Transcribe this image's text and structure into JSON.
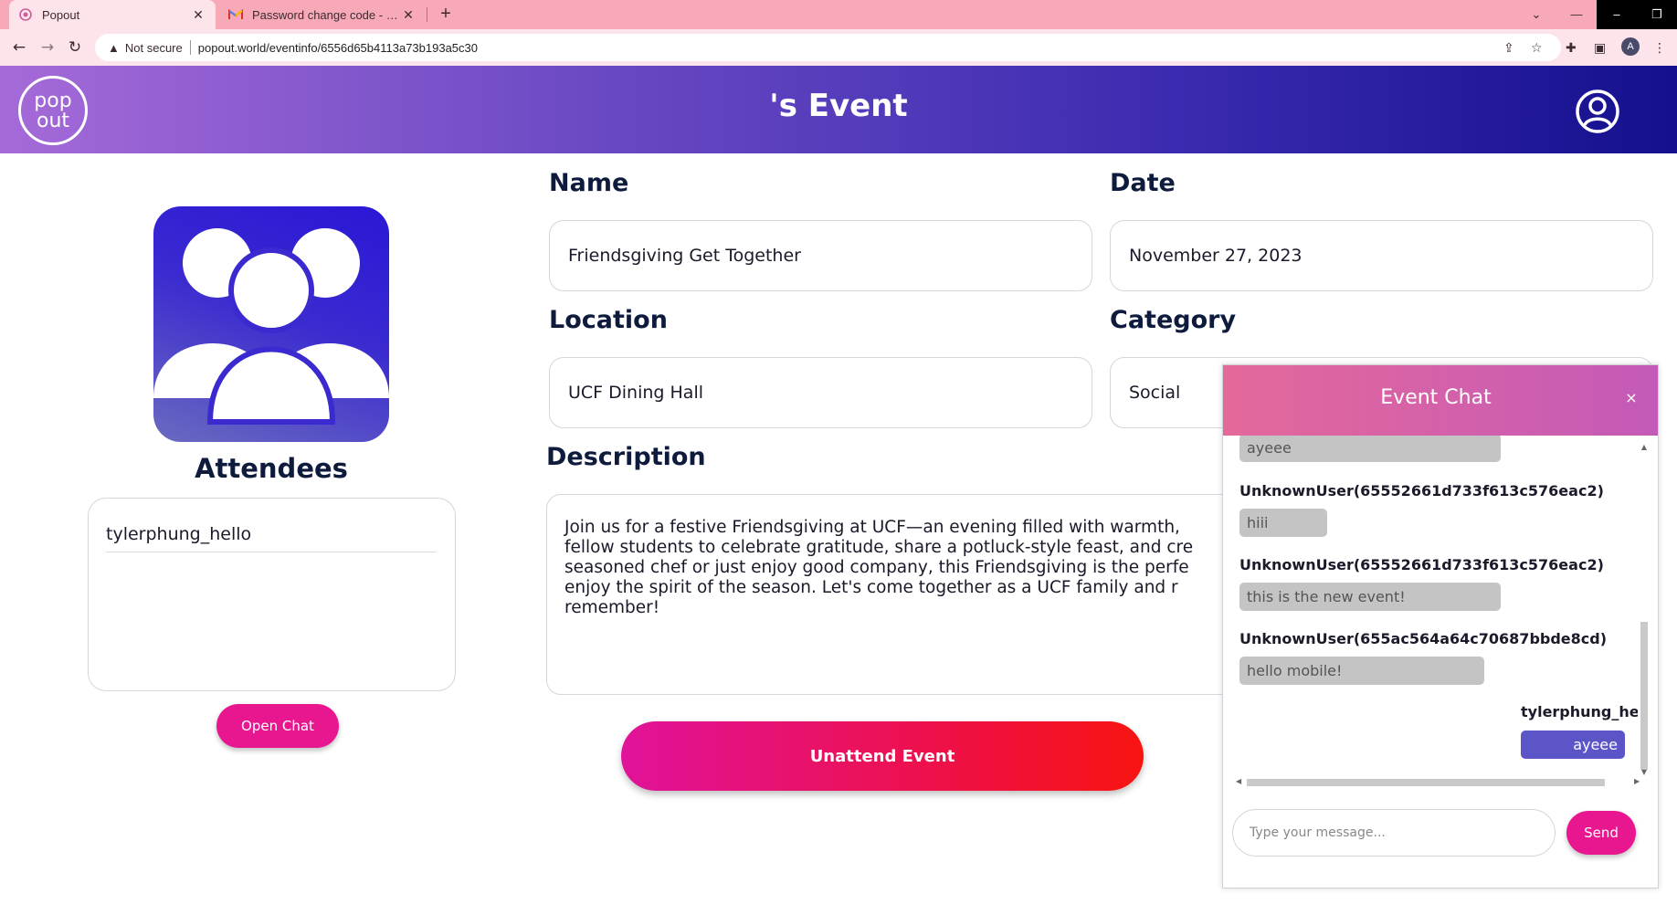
{
  "browser": {
    "tabs": [
      {
        "title": "Popout",
        "favicon": "popout-favicon"
      },
      {
        "title": "Password change code - tylerphung",
        "favicon": "gmail-favicon"
      }
    ],
    "security_label": "Not secure",
    "url": "popout.world/eventinfo/6556d65b4113a73b193a5c30",
    "profile_initial": "A"
  },
  "header": {
    "logo_top": "pop",
    "logo_bottom": "out",
    "title": "'s Event",
    "gradient": [
      "#a56ad8",
      "#14108e"
    ]
  },
  "attendees": {
    "title": "Attendees",
    "list": [
      "tylerphung_hello"
    ],
    "open_chat_label": "Open Chat"
  },
  "event": {
    "name_label": "Name",
    "name_value": "Friendsgiving Get Together",
    "date_label": "Date",
    "date_value": "November 27, 2023",
    "location_label": "Location",
    "location_value": "UCF Dining Hall",
    "category_label": "Category",
    "category_value": "Social",
    "description_label": "Description",
    "description_lines": [
      "Join us for a festive Friendsgiving at UCF—an evening filled with warmth,",
      "fellow students to celebrate gratitude, share a potluck-style feast, and cre",
      "seasoned chef or just enjoy good company, this Friendsgiving is the perfe",
      "enjoy the spirit of the season. Let's come together as a UCF family and r",
      "remember!"
    ],
    "unattend_label": "Unattend Event"
  },
  "chat": {
    "title": "Event Chat",
    "close_symbol": "×",
    "messages": [
      {
        "sender": "",
        "text": "ayeee"
      },
      {
        "sender": "UnknownUser(65552661d733f613c576eac2)",
        "text": "hiii"
      },
      {
        "sender": "UnknownUser(65552661d733f613c576eac2)",
        "text": "this is the new event!"
      },
      {
        "sender": "UnknownUser(655ac564a64c70687bbde8cd)",
        "text": "hello mobile!"
      },
      {
        "sender": "tylerphung_hello",
        "text": "ayeee"
      }
    ],
    "input_placeholder": "Type your message...",
    "send_label": "Send",
    "accent": "#e8168f",
    "own_bubble_color": "#5b55c8"
  }
}
